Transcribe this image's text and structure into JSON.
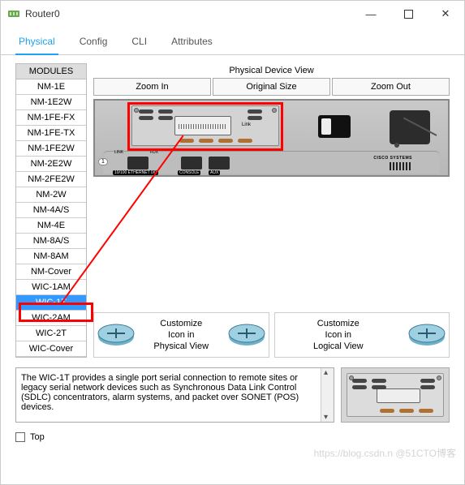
{
  "window": {
    "title": "Router0"
  },
  "tabs": {
    "physical": "Physical",
    "config": "Config",
    "cli": "CLI",
    "attributes": "Attributes"
  },
  "modules": {
    "header": "MODULES",
    "items": [
      "NM-1E",
      "NM-1E2W",
      "NM-1FE-FX",
      "NM-1FE-TX",
      "NM-1FE2W",
      "NM-2E2W",
      "NM-2FE2W",
      "NM-2W",
      "NM-4A/S",
      "NM-4E",
      "NM-8A/S",
      "NM-8AM",
      "NM-Cover",
      "WIC-1AM",
      "WIC-1T",
      "WIC-2AM",
      "WIC-2T",
      "WIC-Cover"
    ],
    "selected_index": 14
  },
  "right": {
    "pdv_label": "Physical Device View",
    "zoom_in": "Zoom In",
    "original": "Original Size",
    "zoom_out": "Zoom Out",
    "link_label": "LINK",
    "fdx_label": "FDX",
    "ethernet_label": "10/100 ETHERNET 0/0",
    "console_label": "CONSOLE",
    "aux_label": "AUX",
    "cisco": "CISCO SYSTEMS",
    "one_label": "1",
    "link2_label": "Link"
  },
  "custom": {
    "phys": "Customize\nIcon in\nPhysical View",
    "logi": "Customize\nIcon in\nLogical View"
  },
  "description": "The WIC-1T provides a single port serial connection to remote sites or legacy serial network devices such as Synchronous Data Link Control (SDLC) concentrators, alarm systems, and packet over SONET (POS) devices.",
  "footer": {
    "top": "Top"
  },
  "watermark": "https://blog.csdn.n @51CTO博客"
}
